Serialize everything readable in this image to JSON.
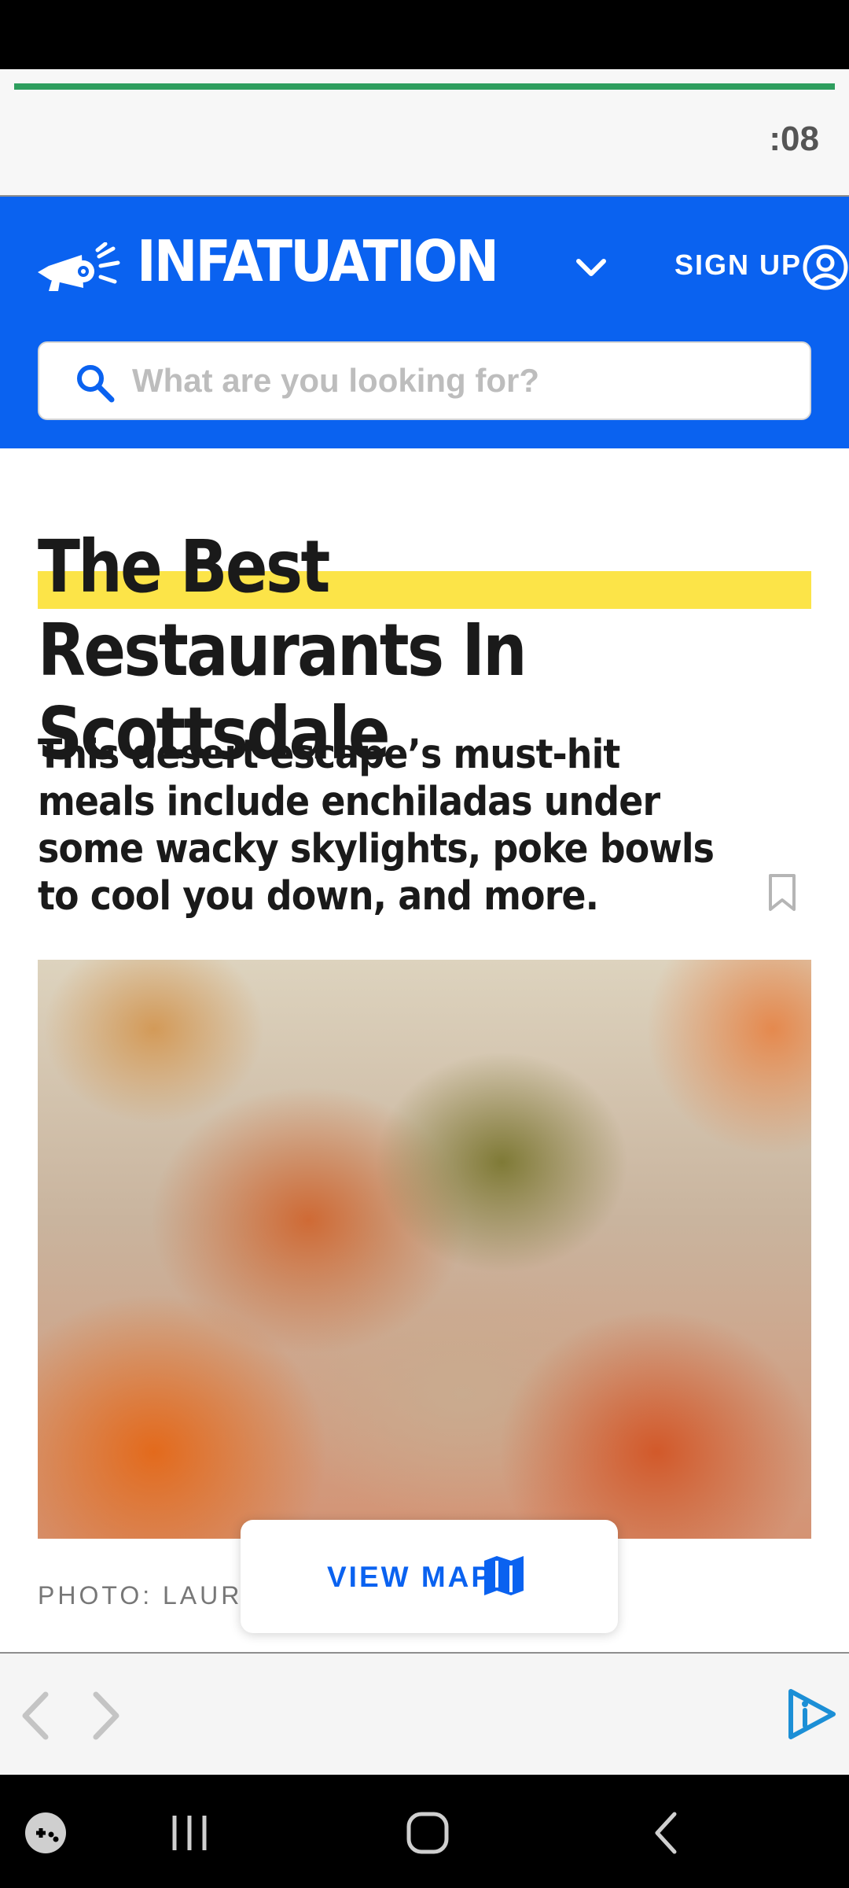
{
  "timer": {
    "text": ":08",
    "progress_fraction": 1.0
  },
  "header": {
    "logo": "INFATUATION",
    "signup_label": "SIGN UP",
    "search_placeholder": "What are you looking for?"
  },
  "article": {
    "title": "The Best Restaurants In Scottsdale",
    "subtitle": "This desert escape’s must-hit meals include enchiladas under some wacky skylights, poke bowls to cool you down, and more.",
    "photo_credit": "PHOTO: LAURE"
  },
  "map_button": {
    "label": "VIEW MAP"
  },
  "icons": {
    "logo": "megaphone-icon",
    "menu": "chevron-down-icon",
    "account": "account-icon",
    "search": "search-icon",
    "bookmark": "bookmark-icon",
    "map": "map-icon",
    "back": "back-arrow-icon",
    "forward": "forward-arrow-icon",
    "brand": "brand-icon"
  },
  "colors": {
    "brand_blue": "#0a62f0",
    "highlight_yellow": "#fce448",
    "progress_green": "#2e9e5e"
  }
}
